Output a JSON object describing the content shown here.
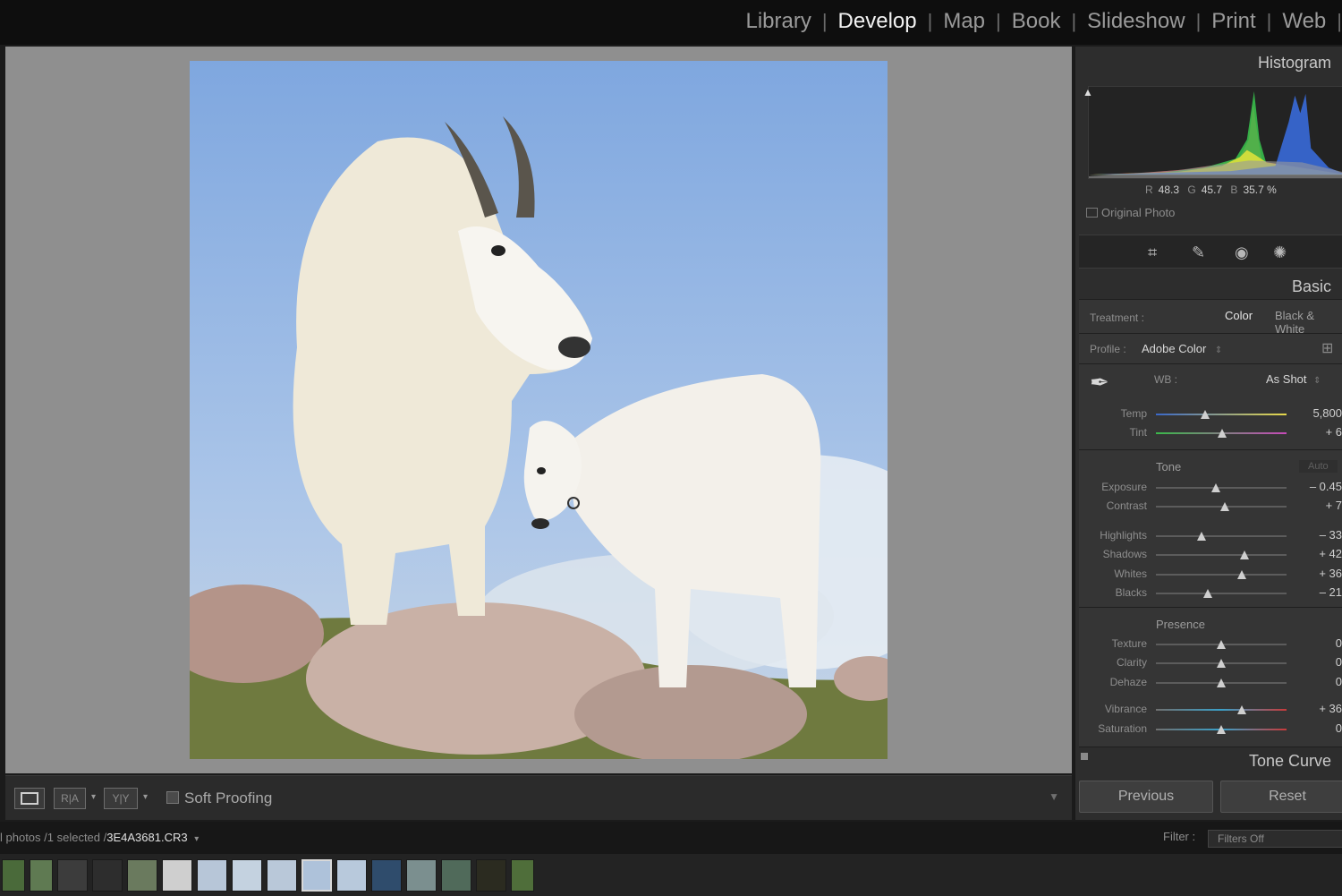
{
  "modules": [
    {
      "label": "Library",
      "active": false
    },
    {
      "label": "Develop",
      "active": true
    },
    {
      "label": "Map",
      "active": false
    },
    {
      "label": "Book",
      "active": false
    },
    {
      "label": "Slideshow",
      "active": false
    },
    {
      "label": "Print",
      "active": false
    },
    {
      "label": "Web",
      "active": false
    }
  ],
  "toolbar": {
    "view_loupe": "loupe-view-icon",
    "view_before_after_ra": "R|A",
    "view_before_after_yy": "Y|Y",
    "soft_proofing": "Soft Proofing",
    "soft_proofing_checked": false
  },
  "histogram": {
    "title": "Histogram",
    "r_label": "R",
    "r_value": "48.3",
    "g_label": "G",
    "g_value": "45.7",
    "b_label": "B",
    "b_value": "35.7 %",
    "original_photo": "Original Photo"
  },
  "tools": [
    "crop-icon",
    "heal-icon",
    "redeye-icon",
    "mask-icon"
  ],
  "basic": {
    "title": "Basic",
    "treatment_label": "Treatment :",
    "treatment_color": "Color",
    "treatment_bw": "Black & White",
    "profile_label": "Profile :",
    "profile_value": "Adobe Color",
    "wb_label": "WB :",
    "wb_value": "As Shot",
    "temp": {
      "label": "Temp",
      "value": "5,800",
      "pos": 0.38
    },
    "tint": {
      "label": "Tint",
      "value": "+ 6",
      "pos": 0.51
    },
    "tone_title": "Tone",
    "tone_auto": "Auto",
    "exposure": {
      "label": "Exposure",
      "value": "– 0.45",
      "pos": 0.46
    },
    "contrast": {
      "label": "Contrast",
      "value": "+ 7",
      "pos": 0.53
    },
    "highlights": {
      "label": "Highlights",
      "value": "– 33",
      "pos": 0.35
    },
    "shadows": {
      "label": "Shadows",
      "value": "+ 42",
      "pos": 0.68
    },
    "whites": {
      "label": "Whites",
      "value": "+ 36",
      "pos": 0.66
    },
    "blacks": {
      "label": "Blacks",
      "value": "– 21",
      "pos": 0.4
    },
    "presence_title": "Presence",
    "texture": {
      "label": "Texture",
      "value": "0",
      "pos": 0.5
    },
    "clarity": {
      "label": "Clarity",
      "value": "0",
      "pos": 0.5
    },
    "dehaze": {
      "label": "Dehaze",
      "value": "0",
      "pos": 0.5
    },
    "vibrance": {
      "label": "Vibrance",
      "value": "+ 36",
      "pos": 0.66
    },
    "saturation": {
      "label": "Saturation",
      "value": "0",
      "pos": 0.5
    }
  },
  "tone_curve": "Tone Curve",
  "buttons": {
    "previous": "Previous",
    "reset": "Reset"
  },
  "filmstrip": {
    "info_prefix": "l photos /1 selected /",
    "filename": "3E4A3681.CR3",
    "filter_label": "Filter :",
    "filter_value": "Filters Off",
    "thumb_colors": [
      "#4a6a3a",
      "#5f7a52",
      "#3c3c3c",
      "#2d2d2d",
      "#6a7a5e",
      "#cfcfcf",
      "#b7c6d8",
      "#c4d2e0",
      "#b9c8d9",
      "#aec2da",
      "#b8c9dc",
      "#2f4c6c",
      "#7b8f8f",
      "#506a5a",
      "#2b2b20",
      "#4f6e3a"
    ],
    "selected_index": 9
  }
}
